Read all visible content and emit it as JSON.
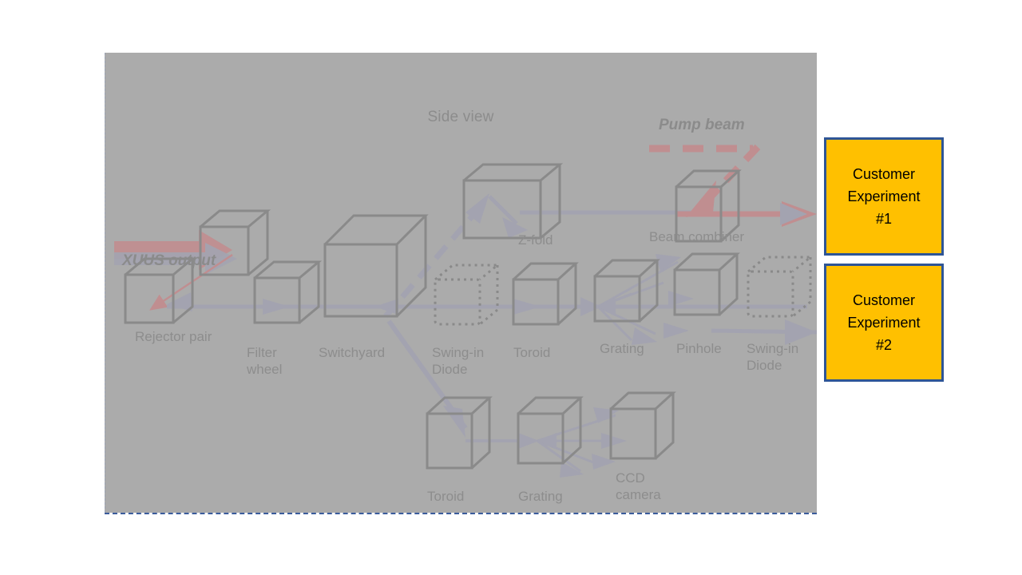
{
  "panel": {
    "title": "Side view",
    "background_color": "#ababab",
    "border_color": "#3b5c9c"
  },
  "annotations": {
    "xuus_output": "XUUS output",
    "pump_beam": "Pump beam"
  },
  "components": {
    "rejector_pair": "Rejector pair",
    "filter_wheel": "Filter\nwheel",
    "switchyard": "Switchyard",
    "swing_in_diode_1": "Swing-in\nDiode",
    "toroid_mid": "Toroid",
    "grating_mid": "Grating",
    "pinhole": "Pinhole",
    "swing_in_diode_2": "Swing-in\nDiode",
    "z_fold": "Z-fold",
    "beam_combiner": "Beam combiner",
    "toroid_bottom": "Toroid",
    "grating_bottom": "Grating",
    "ccd_camera": "CCD\ncamera"
  },
  "outputs": {
    "experiment_1": "Customer\nExperiment\n#1",
    "experiment_2": "Customer\nExperiment\n#2"
  },
  "colors": {
    "beam_gray": "#a3a3b0",
    "beam_red": "#c08e90",
    "box_outline": "#8a8a8a",
    "label_text": "#8d8d8d",
    "experiment_fill": "#ffc000",
    "experiment_border": "#2e5596"
  }
}
